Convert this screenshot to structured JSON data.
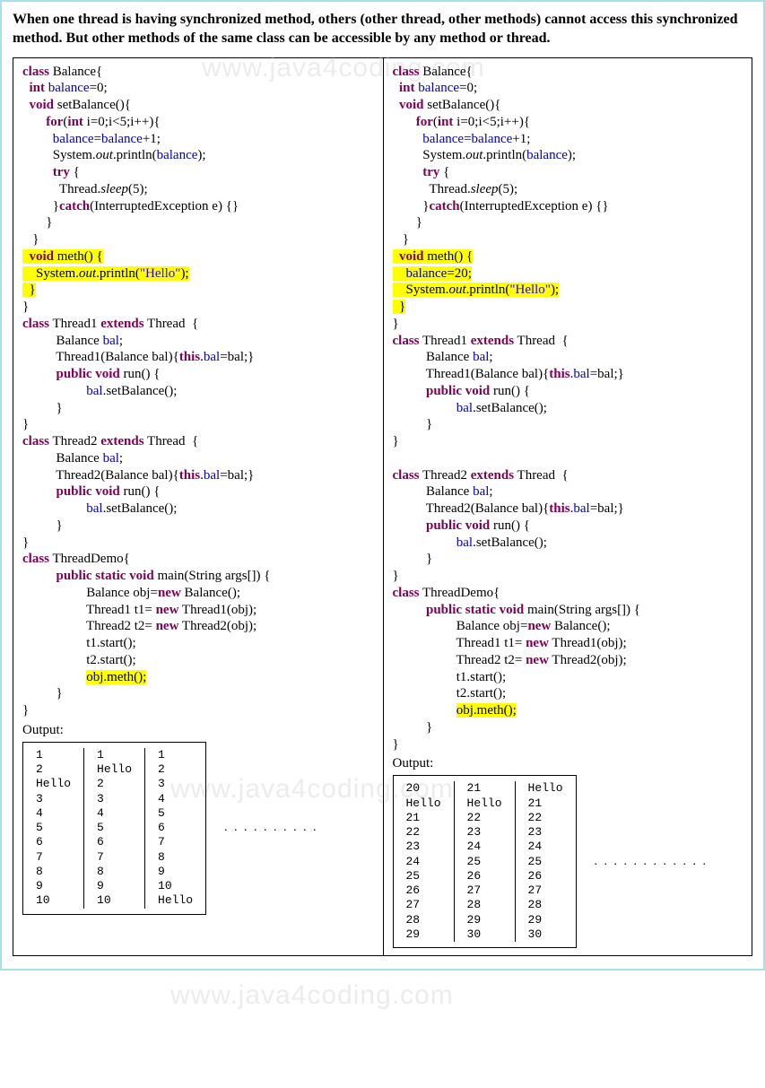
{
  "heading": "When one thread is having synchronized method, others (other thread, other methods) cannot access this synchronized method. But other methods of the same class can be accessible by any method or thread.",
  "watermark": "www.java4coding.com",
  "left": {
    "code_tokens": [
      [
        [
          "kw",
          "class"
        ],
        [
          "",
          " Balance{"
        ]
      ],
      [
        [
          "",
          "  "
        ],
        [
          "kw",
          "int"
        ],
        [
          "",
          " "
        ],
        [
          "var",
          "balance"
        ],
        [
          "",
          "=0;"
        ]
      ],
      [
        [
          "",
          "  "
        ],
        [
          "kw",
          "void"
        ],
        [
          "",
          " setBalance(){"
        ]
      ],
      [
        [
          "",
          "       "
        ],
        [
          "kw",
          "for"
        ],
        [
          "",
          "("
        ],
        [
          "kw",
          "int"
        ],
        [
          "",
          " i=0;i<5;i++){"
        ]
      ],
      [
        [
          "",
          "         "
        ],
        [
          "var",
          "balance"
        ],
        [
          "",
          "="
        ],
        [
          "var",
          "balance"
        ],
        [
          "",
          "+1;"
        ]
      ],
      [
        [
          "",
          "         System."
        ],
        [
          "it",
          "out"
        ],
        [
          "",
          ".println("
        ],
        [
          "var",
          "balance"
        ],
        [
          "",
          ");"
        ]
      ],
      [
        [
          "",
          "         "
        ],
        [
          "kw",
          "try"
        ],
        [
          "",
          " {"
        ]
      ],
      [
        [
          "",
          "           Thread."
        ],
        [
          "it",
          "sleep"
        ],
        [
          "",
          "(5);"
        ]
      ],
      [
        [
          "",
          "         }"
        ],
        [
          "kw",
          "catch"
        ],
        [
          "",
          "(InterruptedException e) {}"
        ]
      ],
      [
        [
          "",
          "       }"
        ]
      ],
      [
        [
          "",
          "   }"
        ]
      ],
      [
        [
          "hl",
          "  "
        ],
        [
          "hlkw",
          "void"
        ],
        [
          "hl",
          " meth() {"
        ]
      ],
      [
        [
          "hl",
          "    System."
        ],
        [
          "hlit",
          "out"
        ],
        [
          "hl",
          ".println("
        ],
        [
          "hlstr",
          "\"Hello\""
        ],
        [
          "hl",
          ");"
        ]
      ],
      [
        [
          "hl",
          "  }"
        ]
      ],
      [
        [
          "",
          "}"
        ]
      ],
      [
        [
          "kw",
          "class"
        ],
        [
          "",
          " Thread1 "
        ],
        [
          "kw",
          "extends"
        ],
        [
          "",
          " Thread  {"
        ]
      ],
      [
        [
          "",
          "          Balance "
        ],
        [
          "var",
          "bal"
        ],
        [
          "",
          ";"
        ]
      ],
      [
        [
          "",
          "          Thread1(Balance bal){"
        ],
        [
          "kw",
          "this"
        ],
        [
          "",
          "."
        ],
        [
          "var",
          "bal"
        ],
        [
          "",
          "=bal;}"
        ]
      ],
      [
        [
          "",
          "          "
        ],
        [
          "kw",
          "public void"
        ],
        [
          "",
          " run() {"
        ]
      ],
      [
        [
          "",
          "                   "
        ],
        [
          "var",
          "bal"
        ],
        [
          "",
          ".setBalance();"
        ]
      ],
      [
        [
          "",
          "          }"
        ]
      ],
      [
        [
          "",
          "}"
        ]
      ],
      [
        [
          "kw",
          "class"
        ],
        [
          "",
          " Thread2 "
        ],
        [
          "kw",
          "extends"
        ],
        [
          "",
          " Thread  {"
        ]
      ],
      [
        [
          "",
          "          Balance "
        ],
        [
          "var",
          "bal"
        ],
        [
          "",
          ";"
        ]
      ],
      [
        [
          "",
          "          Thread2(Balance bal){"
        ],
        [
          "kw",
          "this"
        ],
        [
          "",
          "."
        ],
        [
          "var",
          "bal"
        ],
        [
          "",
          "=bal;}"
        ]
      ],
      [
        [
          "",
          "          "
        ],
        [
          "kw",
          "public void"
        ],
        [
          "",
          " run() {"
        ]
      ],
      [
        [
          "",
          "                   "
        ],
        [
          "var",
          "bal"
        ],
        [
          "",
          ".setBalance();"
        ]
      ],
      [
        [
          "",
          "          }"
        ]
      ],
      [
        [
          "",
          "}"
        ]
      ],
      [
        [
          "kw",
          "class"
        ],
        [
          "",
          " ThreadDemo{"
        ]
      ],
      [
        [
          "",
          "          "
        ],
        [
          "kw",
          "public static void"
        ],
        [
          "",
          " main(String args[]) {"
        ]
      ],
      [
        [
          "",
          "                   Balance obj="
        ],
        [
          "kw",
          "new"
        ],
        [
          "",
          " Balance();"
        ]
      ],
      [
        [
          "",
          "                   Thread1 t1= "
        ],
        [
          "kw",
          "new"
        ],
        [
          "",
          " Thread1(obj);"
        ]
      ],
      [
        [
          "",
          "                   Thread2 t2= "
        ],
        [
          "kw",
          "new"
        ],
        [
          "",
          " Thread2(obj);"
        ]
      ],
      [
        [
          "",
          "                   t1.start();"
        ]
      ],
      [
        [
          "",
          "                   t2.start();"
        ]
      ],
      [
        [
          "",
          "                   "
        ],
        [
          "hl",
          "obj.meth();"
        ]
      ],
      [
        [
          "",
          "          }"
        ]
      ],
      [
        [
          "",
          "}"
        ]
      ]
    ],
    "output_label": "Output:",
    "output_cols": [
      [
        "1",
        "2",
        "Hello",
        "3",
        "4",
        "5",
        "6",
        "7",
        "8",
        "9",
        "10"
      ],
      [
        "1",
        "Hello",
        "2",
        "3",
        "4",
        "5",
        "6",
        "7",
        "8",
        "9",
        "10"
      ],
      [
        "1",
        "2",
        "3",
        "4",
        "5",
        "6",
        "7",
        "8",
        "9",
        "10",
        "Hello"
      ]
    ],
    "dots": ". . . . . . . . . ."
  },
  "right": {
    "code_tokens": [
      [
        [
          "kw",
          "class"
        ],
        [
          "",
          " Balance{"
        ]
      ],
      [
        [
          "",
          "  "
        ],
        [
          "kw",
          "int"
        ],
        [
          "",
          " "
        ],
        [
          "var",
          "balance"
        ],
        [
          "",
          "=0;"
        ]
      ],
      [
        [
          "",
          "  "
        ],
        [
          "kw",
          "void"
        ],
        [
          "",
          " setBalance(){"
        ]
      ],
      [
        [
          "",
          "       "
        ],
        [
          "kw",
          "for"
        ],
        [
          "",
          "("
        ],
        [
          "kw",
          "int"
        ],
        [
          "",
          " i=0;i<5;i++){"
        ]
      ],
      [
        [
          "",
          "         "
        ],
        [
          "var",
          "balance"
        ],
        [
          "",
          "="
        ],
        [
          "var",
          "balance"
        ],
        [
          "",
          "+1;"
        ]
      ],
      [
        [
          "",
          "         System."
        ],
        [
          "it",
          "out"
        ],
        [
          "",
          ".println("
        ],
        [
          "var",
          "balance"
        ],
        [
          "",
          ");"
        ]
      ],
      [
        [
          "",
          "         "
        ],
        [
          "kw",
          "try"
        ],
        [
          "",
          " {"
        ]
      ],
      [
        [
          "",
          "           Thread."
        ],
        [
          "it",
          "sleep"
        ],
        [
          "",
          "(5);"
        ]
      ],
      [
        [
          "",
          "         }"
        ],
        [
          "kw",
          "catch"
        ],
        [
          "",
          "(InterruptedException e) {}"
        ]
      ],
      [
        [
          "",
          "       }"
        ]
      ],
      [
        [
          "",
          "   }"
        ]
      ],
      [
        [
          "hl",
          "  "
        ],
        [
          "hlkw",
          "void"
        ],
        [
          "hl",
          " meth() {"
        ]
      ],
      [
        [
          "hl",
          "    "
        ],
        [
          "hlvar",
          "balance"
        ],
        [
          "hl",
          "=20;"
        ]
      ],
      [
        [
          "hl",
          "    System."
        ],
        [
          "hlit",
          "out"
        ],
        [
          "hl",
          ".println("
        ],
        [
          "hlstr",
          "\"Hello\""
        ],
        [
          "hl",
          ");"
        ]
      ],
      [
        [
          "hl",
          "  }"
        ]
      ],
      [
        [
          "",
          "}"
        ]
      ],
      [
        [
          "kw",
          "class"
        ],
        [
          "",
          " Thread1 "
        ],
        [
          "kw",
          "extends"
        ],
        [
          "",
          " Thread  {"
        ]
      ],
      [
        [
          "",
          "          Balance "
        ],
        [
          "var",
          "bal"
        ],
        [
          "",
          ";"
        ]
      ],
      [
        [
          "",
          "          Thread1(Balance bal){"
        ],
        [
          "kw",
          "this"
        ],
        [
          "",
          "."
        ],
        [
          "var",
          "bal"
        ],
        [
          "",
          "=bal;}"
        ]
      ],
      [
        [
          "",
          "          "
        ],
        [
          "kw",
          "public void"
        ],
        [
          "",
          " run() {"
        ]
      ],
      [
        [
          "",
          "                   "
        ],
        [
          "var",
          "bal"
        ],
        [
          "",
          ".setBalance();"
        ]
      ],
      [
        [
          "",
          "          }"
        ]
      ],
      [
        [
          "",
          "}"
        ]
      ],
      [
        [
          "",
          "          "
        ]
      ],
      [
        [
          "kw",
          "class"
        ],
        [
          "",
          " Thread2 "
        ],
        [
          "kw",
          "extends"
        ],
        [
          "",
          " Thread  {"
        ]
      ],
      [
        [
          "",
          "          Balance "
        ],
        [
          "var",
          "bal"
        ],
        [
          "",
          ";"
        ]
      ],
      [
        [
          "",
          "          Thread2(Balance bal){"
        ],
        [
          "kw",
          "this"
        ],
        [
          "",
          "."
        ],
        [
          "var",
          "bal"
        ],
        [
          "",
          "=bal;}"
        ]
      ],
      [
        [
          "",
          "          "
        ],
        [
          "kw",
          "public void"
        ],
        [
          "",
          " run() {"
        ]
      ],
      [
        [
          "",
          "                   "
        ],
        [
          "var",
          "bal"
        ],
        [
          "",
          ".setBalance();"
        ]
      ],
      [
        [
          "",
          "          }"
        ]
      ],
      [
        [
          "",
          "}"
        ]
      ],
      [
        [
          "kw",
          "class"
        ],
        [
          "",
          " ThreadDemo{"
        ]
      ],
      [
        [
          "",
          "          "
        ],
        [
          "kw",
          "public static void"
        ],
        [
          "",
          " main(String args[]) {"
        ]
      ],
      [
        [
          "",
          "                   Balance obj="
        ],
        [
          "kw",
          "new"
        ],
        [
          "",
          " Balance();"
        ]
      ],
      [
        [
          "",
          "                   Thread1 t1= "
        ],
        [
          "kw",
          "new"
        ],
        [
          "",
          " Thread1(obj);"
        ]
      ],
      [
        [
          "",
          "                   Thread2 t2= "
        ],
        [
          "kw",
          "new"
        ],
        [
          "",
          " Thread2(obj);"
        ]
      ],
      [
        [
          "",
          "                   t1.start();"
        ]
      ],
      [
        [
          "",
          "                   t2.start();"
        ]
      ],
      [
        [
          "",
          "                   "
        ],
        [
          "hl",
          "obj.meth();"
        ]
      ],
      [
        [
          "",
          "          }"
        ]
      ],
      [
        [
          "",
          "}"
        ]
      ]
    ],
    "output_label": "Output:",
    "output_cols": [
      [
        "20",
        "Hello",
        "21",
        "22",
        "23",
        "24",
        "25",
        "26",
        "27",
        "28",
        "29"
      ],
      [
        "21",
        "Hello",
        "22",
        "23",
        "24",
        "25",
        "26",
        "27",
        "28",
        "29",
        "30"
      ],
      [
        "Hello",
        "21",
        "22",
        "23",
        "24",
        "25",
        "26",
        "27",
        "28",
        "29",
        "30"
      ]
    ],
    "dots": ". . . . . . . . . . . ."
  }
}
